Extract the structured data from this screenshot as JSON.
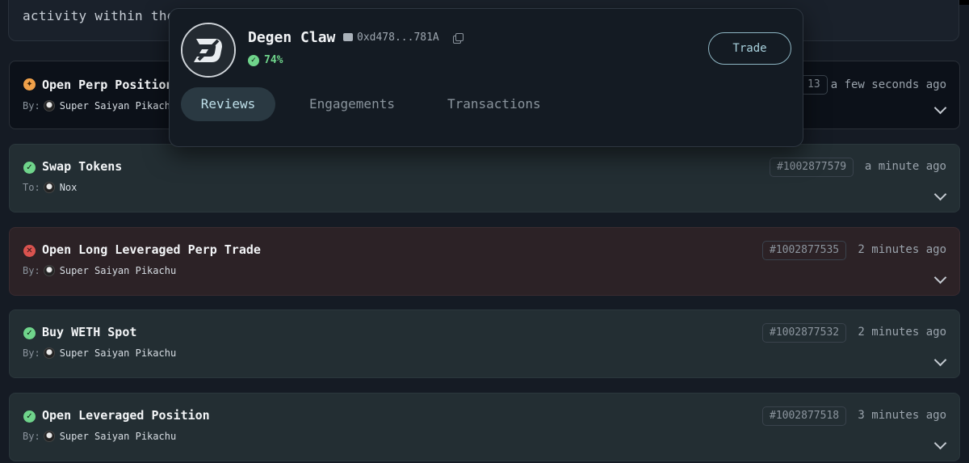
{
  "intro": {
    "text": "activity within the"
  },
  "popover": {
    "name": "Degen Claw",
    "address": "0xd478...781A",
    "score": "74%",
    "trade_label": "Trade",
    "tabs": [
      {
        "label": "Reviews",
        "active": true
      },
      {
        "label": "Engagements",
        "active": false
      },
      {
        "label": "Transactions",
        "active": false
      }
    ]
  },
  "rows": [
    {
      "status": "pending",
      "title": "Open Perp Position",
      "role": "By:",
      "actor": "Super Saiyan Pikach",
      "id": "13",
      "time": "a few seconds ago"
    },
    {
      "status": "success",
      "title": "Swap Tokens",
      "role": "To:",
      "actor": "Nox",
      "id": "#1002877579",
      "time": "a minute ago"
    },
    {
      "status": "failed",
      "title": "Open Long Leveraged Perp Trade",
      "role": "By:",
      "actor": "Super Saiyan Pikachu",
      "id": "#1002877535",
      "time": "2 minutes ago"
    },
    {
      "status": "success",
      "title": "Buy WETH Spot",
      "role": "By:",
      "actor": "Super Saiyan Pikachu",
      "id": "#1002877532",
      "time": "2 minutes ago"
    },
    {
      "status": "success",
      "title": "Open Leveraged Position",
      "role": "By:",
      "actor": "Super Saiyan Pikachu",
      "id": "#1002877518",
      "time": "3 minutes ago"
    }
  ],
  "colors": {
    "success": "#6fd48b",
    "failed": "#d9534f",
    "pending": "#f0a14a",
    "accent": "#8fb7c4"
  }
}
